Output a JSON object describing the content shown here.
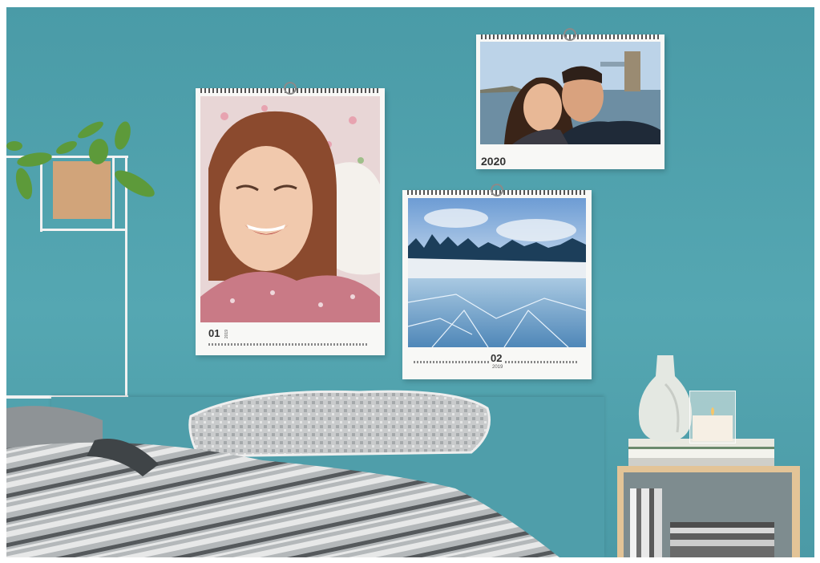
{
  "scene": {
    "colors": {
      "wall": "#4fa2ae",
      "headboard": "#4f9eaa",
      "bedding_grey": "#9aa0a3",
      "wood": "#d9b78a"
    }
  },
  "calendars": [
    {
      "month_label": "01",
      "year_label": "2019",
      "photo_icon": "laughing-girl-photo"
    },
    {
      "month_label": "02",
      "year_label": "2019",
      "photo_icon": "frozen-lake-photo"
    },
    {
      "year_label": "2020",
      "photo_icon": "couple-selfie-photo"
    }
  ]
}
